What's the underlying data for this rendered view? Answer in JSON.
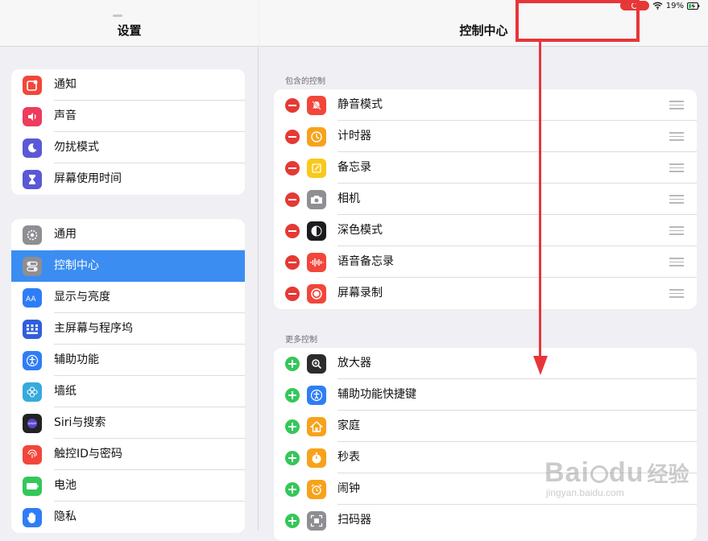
{
  "status": {
    "battery": "19%"
  },
  "left": {
    "title": "设置",
    "group1": [
      {
        "label": "通知",
        "icon": "notification-icon",
        "color": "#f2463a"
      },
      {
        "label": "声音",
        "icon": "sound-icon",
        "color": "#ee3b5e"
      },
      {
        "label": "勿扰模式",
        "icon": "moon-icon",
        "color": "#5b58d6"
      },
      {
        "label": "屏幕使用时间",
        "icon": "hourglass-icon",
        "color": "#5b58d6"
      }
    ],
    "group2": [
      {
        "label": "通用",
        "icon": "gear-icon",
        "color": "#8e8e93"
      },
      {
        "label": "控制中心",
        "icon": "control-center-icon",
        "color": "#8e8e93",
        "selected": true
      },
      {
        "label": "显示与亮度",
        "icon": "display-icon",
        "color": "#2f7df6"
      },
      {
        "label": "主屏幕与程序坞",
        "icon": "home-screen-icon",
        "color": "#2f5fdc"
      },
      {
        "label": "辅助功能",
        "icon": "accessibility-icon",
        "color": "#2f7df6"
      },
      {
        "label": "墙纸",
        "icon": "wallpaper-icon",
        "color": "#37aadc"
      },
      {
        "label": "Siri与搜索",
        "icon": "siri-icon",
        "color": "#222222"
      },
      {
        "label": "触控ID与密码",
        "icon": "fingerprint-icon",
        "color": "#f2463a"
      },
      {
        "label": "电池",
        "icon": "battery-icon",
        "color": "#34c759"
      },
      {
        "label": "隐私",
        "icon": "hand-icon",
        "color": "#2f7df6"
      }
    ]
  },
  "right": {
    "title": "控制中心",
    "included_label": "包含的控制",
    "included": [
      {
        "label": "静音模式",
        "icon": "bell-slash-icon",
        "color": "#f2463a"
      },
      {
        "label": "计时器",
        "icon": "timer-icon",
        "color": "#f7a21b"
      },
      {
        "label": "备忘录",
        "icon": "notes-icon",
        "color": "#f9c91a"
      },
      {
        "label": "相机",
        "icon": "camera-icon",
        "color": "#8e8e93"
      },
      {
        "label": "深色模式",
        "icon": "dark-mode-icon",
        "color": "#1c1c1e"
      },
      {
        "label": "语音备忘录",
        "icon": "waveform-icon",
        "color": "#f2463a"
      },
      {
        "label": "屏幕录制",
        "icon": "record-icon",
        "color": "#f2463a"
      }
    ],
    "more_label": "更多控制",
    "more": [
      {
        "label": "放大器",
        "icon": "magnifier-icon",
        "color": "#2c2c2e"
      },
      {
        "label": "辅助功能快捷键",
        "icon": "accessibility-icon",
        "color": "#2f7df6"
      },
      {
        "label": "家庭",
        "icon": "home-icon",
        "color": "#f7a21b"
      },
      {
        "label": "秒表",
        "icon": "stopwatch-icon",
        "color": "#f7a21b"
      },
      {
        "label": "闹钟",
        "icon": "alarm-icon",
        "color": "#f7a21b"
      },
      {
        "label": "扫码器",
        "icon": "qr-scanner-icon",
        "color": "#8e8e93"
      }
    ]
  },
  "watermark": {
    "brand": "Bai",
    "brand2": "du",
    "cn": "经验",
    "url": "jingyan.baidu.com"
  }
}
